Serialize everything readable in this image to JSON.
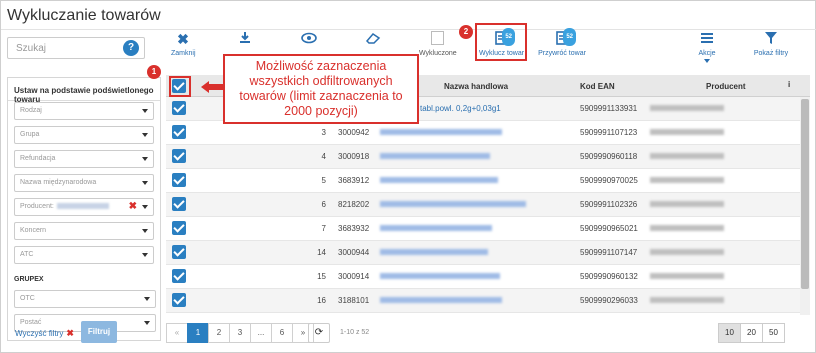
{
  "title": "Wykluczanie towarów",
  "search": {
    "placeholder": "Szukaj",
    "button_glyph": "?"
  },
  "filters": {
    "heading": "Ustaw na podstawie podświetlonego towaru",
    "fields": [
      "Rodzaj",
      "Grupa",
      "Refundacja",
      "Nazwa międzynarodowa",
      "Producent:",
      "Koncern",
      "ATC"
    ],
    "grupex_label": "GRUPEX",
    "grupex_fields": [
      "OTC",
      "Postać"
    ],
    "clear_label": "Wyczyść filtry",
    "apply_label": "Filtruj"
  },
  "toolbar": {
    "close": "Zamknij",
    "excluded": "Wykluczone",
    "exclude": "Wyklucz towar",
    "restore": "Przywróć towar",
    "actions": "Akcje",
    "show_filters": "Pokaż filtry",
    "badge_count": "52"
  },
  "annotations": {
    "marker1": "1",
    "marker2": "2",
    "callout": "Możliwość zaznaczenia wszystkich odfiltrowanych towarów (limit zaznaczenia to 2000 pozycji)"
  },
  "table": {
    "headers": {
      "name": "Nazwa handlowa",
      "ean": "Kod EAN",
      "producer": "Producent",
      "info": "i"
    },
    "rows": [
      {
        "lp": "",
        "code": "",
        "name": "tabl.powl. 0,2g+0,03g1",
        "ean": "5909991133931"
      },
      {
        "lp": "3",
        "code": "3000942",
        "name": "",
        "ean": "5909991107123"
      },
      {
        "lp": "4",
        "code": "3000918",
        "name": "",
        "ean": "5909990960118"
      },
      {
        "lp": "5",
        "code": "3683912",
        "name": "",
        "ean": "5909990970025"
      },
      {
        "lp": "6",
        "code": "8218202",
        "name": "",
        "ean": "5909991102326"
      },
      {
        "lp": "7",
        "code": "3683932",
        "name": "",
        "ean": "5909990965021"
      },
      {
        "lp": "14",
        "code": "3000944",
        "name": "",
        "ean": "5909991107147"
      },
      {
        "lp": "15",
        "code": "3000914",
        "name": "",
        "ean": "5909990960132"
      },
      {
        "lp": "16",
        "code": "3188101",
        "name": "",
        "ean": "5909990296033"
      }
    ]
  },
  "pagination": {
    "prev": "«",
    "next": "»",
    "ellipsis": "...",
    "pages": [
      "1",
      "2",
      "3",
      "6"
    ],
    "active_page": "1",
    "range": "1-10 z 52",
    "page_sizes": [
      "10",
      "20",
      "50"
    ],
    "active_size": "10"
  },
  "colors": {
    "accent": "#2a7fc1",
    "alert": "#d9302c"
  }
}
